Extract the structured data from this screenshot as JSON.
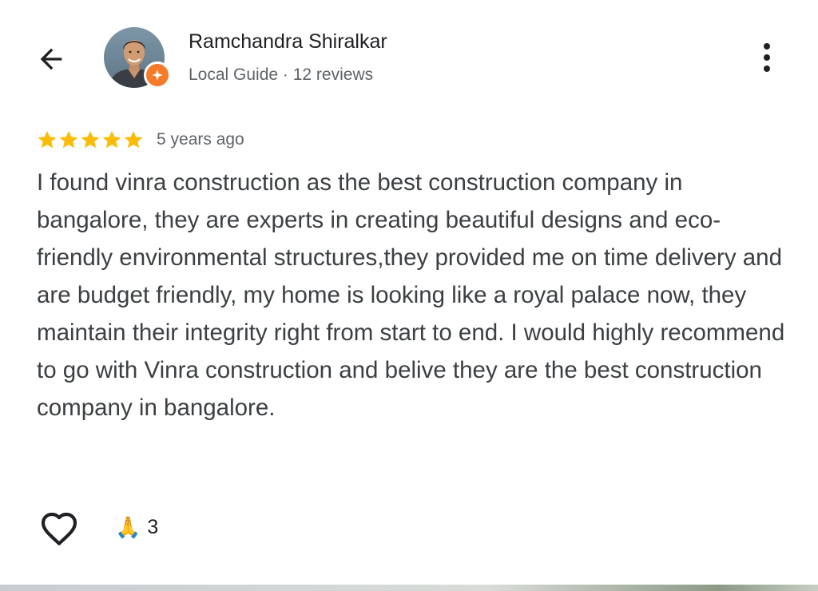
{
  "header": {
    "user_name": "Ramchandra Shiralkar",
    "user_meta": "Local Guide · 12 reviews",
    "icons": {
      "back": "arrow-left-icon",
      "badge": "local-guide-star-badge",
      "more": "more-vertical-icon"
    }
  },
  "review": {
    "rating": 5,
    "max_rating": 5,
    "time_ago": "5 years ago",
    "text": "I found vinra construction as the best construction company in bangalore, they are experts in creating beautiful designs and eco-friendly environmental structures,they provided me on time delivery and are budget friendly, my home is looking like a royal palace now, they maintain their integrity right from start to end. I would highly recommend to go with Vinra construction and belive they are the best construction company in bangalore."
  },
  "actions": {
    "like_icon": "heart-outline-icon",
    "reaction_emoji": "🙏",
    "reaction_count": "3"
  },
  "colors": {
    "star": "#fbbc04",
    "badge": "#f47b2a",
    "text_primary": "#202124",
    "text_body": "#3c4043",
    "text_secondary": "#5f6368"
  }
}
